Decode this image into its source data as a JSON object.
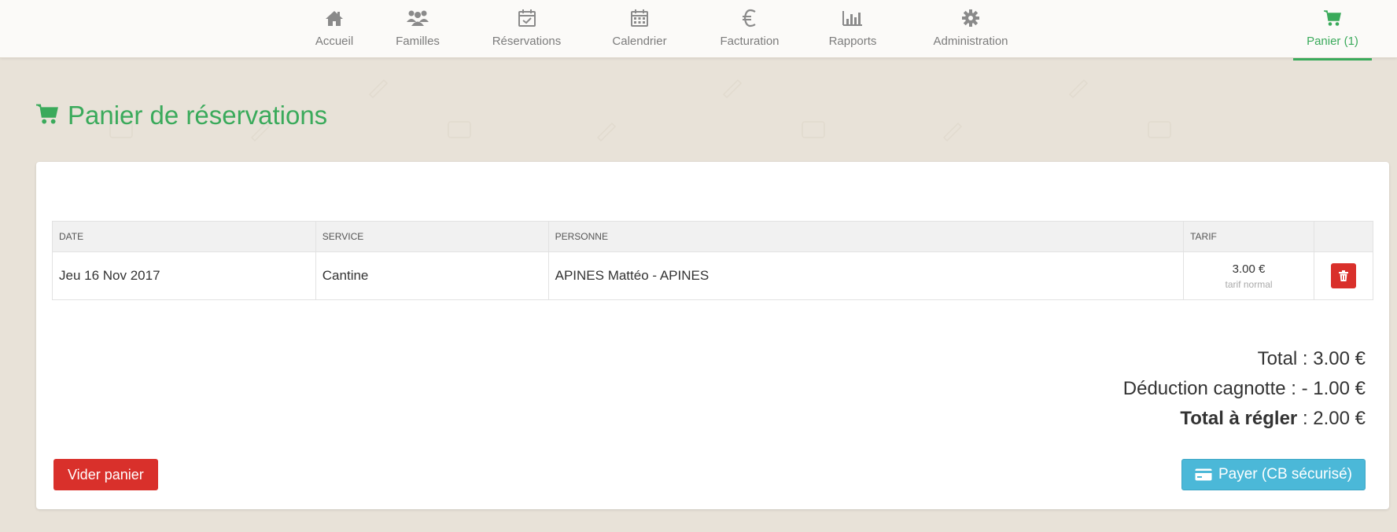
{
  "nav": {
    "items": [
      {
        "label": "Accueil",
        "icon": "home-icon"
      },
      {
        "label": "Familles",
        "icon": "users-icon"
      },
      {
        "label": "Réservations",
        "icon": "calendar-check-icon"
      },
      {
        "label": "Calendrier",
        "icon": "calendar-icon"
      },
      {
        "label": "Facturation",
        "icon": "euro-icon"
      },
      {
        "label": "Rapports",
        "icon": "bar-chart-icon"
      },
      {
        "label": "Administration",
        "icon": "gear-icon"
      }
    ],
    "cart": {
      "label": "Panier (1)",
      "icon": "cart-icon"
    }
  },
  "page": {
    "title": "Panier de réservations",
    "title_icon": "cart-icon"
  },
  "table": {
    "headers": {
      "date": "DATE",
      "service": "SERVICE",
      "person": "PERSONNE",
      "tarif": "TARIF"
    },
    "rows": [
      {
        "date": "Jeu 16 Nov 2017",
        "service": "Cantine",
        "person": "APINES Mattéo - APINES",
        "amount": "3.00 €",
        "tarif_kind": "tarif normal",
        "action_icon": "trash-icon"
      }
    ]
  },
  "totals": {
    "total_label": "Total :",
    "total_value": "3.00 €",
    "deduction_label": "Déduction cagnotte :",
    "deduction_value": "- 1.00 €",
    "due_label": "Total à régler",
    "due_value": ": 2.00 €"
  },
  "actions": {
    "empty_label": "Vider panier",
    "pay_label": "Payer (CB sécurisé)",
    "pay_icon": "credit-card-icon"
  },
  "colors": {
    "accent_green": "#3aaa5b",
    "danger_red": "#d9302b",
    "info_blue": "#4bb8d8",
    "background": "#e8e2d8"
  }
}
